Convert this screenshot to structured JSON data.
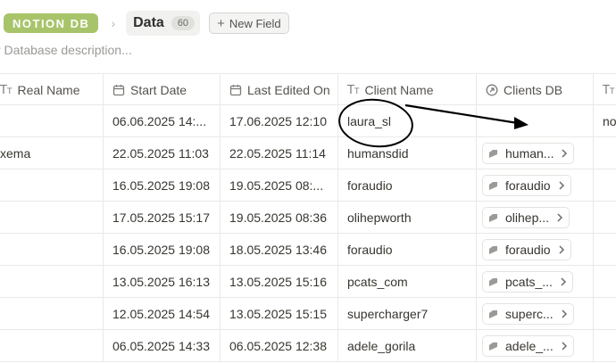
{
  "topbar": {
    "badge": "NOTION DB",
    "title": "Data",
    "count": "60",
    "new_field": "New Field"
  },
  "description_placeholder": "r Database description...",
  "columns": [
    {
      "label": "Real Name",
      "icon": "text-icon"
    },
    {
      "label": "Start Date",
      "icon": "calendar-icon"
    },
    {
      "label": "Last Edited On",
      "icon": "calendar-icon"
    },
    {
      "label": "Client Name",
      "icon": "text-icon"
    },
    {
      "label": "Clients DB",
      "icon": "relation-icon"
    },
    {
      "label": "",
      "icon": "text-icon"
    }
  ],
  "rows": [
    {
      "real_name": "",
      "start_date": "06.06.2025 14:...",
      "last_edited": "17.06.2025 12:10",
      "client_name": "laura_sl",
      "clients_db": "",
      "extra": "no"
    },
    {
      "real_name": "xema",
      "start_date": "22.05.2025 11:03",
      "last_edited": "22.05.2025 11:14",
      "client_name": "humansdid",
      "clients_db": "human...",
      "extra": ""
    },
    {
      "real_name": "",
      "start_date": "16.05.2025 19:08",
      "last_edited": "19.05.2025 08:...",
      "client_name": "foraudio",
      "clients_db": "foraudio",
      "extra": ""
    },
    {
      "real_name": "",
      "start_date": "17.05.2025 15:17",
      "last_edited": "19.05.2025 08:36",
      "client_name": "olihepworth",
      "clients_db": "olihep...",
      "extra": ""
    },
    {
      "real_name": "",
      "start_date": "16.05.2025 19:08",
      "last_edited": "18.05.2025 13:46",
      "client_name": "foraudio",
      "clients_db": "foraudio",
      "extra": ""
    },
    {
      "real_name": "",
      "start_date": "13.05.2025 16:13",
      "last_edited": "13.05.2025 15:16",
      "client_name": "pcats_com",
      "clients_db": "pcats_...",
      "extra": ""
    },
    {
      "real_name": "",
      "start_date": "12.05.2025 14:54",
      "last_edited": "13.05.2025 15:15",
      "client_name": "supercharger7",
      "clients_db": "superc...",
      "extra": ""
    },
    {
      "real_name": "",
      "start_date": "06.05.2025 14:33",
      "last_edited": "06.05.2025 12:38",
      "client_name": "adele_gorila",
      "clients_db": "adele_...",
      "extra": ""
    }
  ],
  "colors": {
    "badge": "#a8c46a",
    "annotation": "#000000",
    "grid": "#e9e9e7"
  }
}
